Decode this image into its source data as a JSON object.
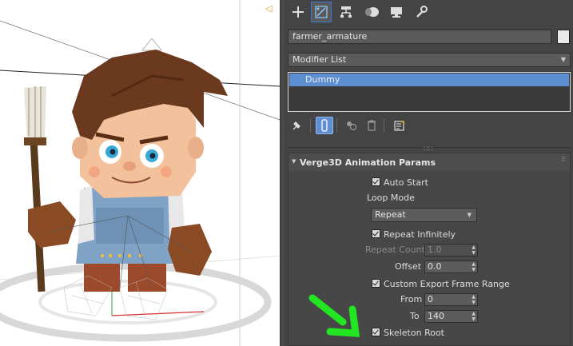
{
  "viewport": {
    "label": "3D viewport - farmer character",
    "grid_arrow": "◁"
  },
  "tabs": [
    {
      "name": "create",
      "icon": "plus-icon"
    },
    {
      "name": "modify",
      "icon": "modify-icon",
      "active": true
    },
    {
      "name": "hierarchy",
      "icon": "hierarchy-icon"
    },
    {
      "name": "motion",
      "icon": "motion-icon"
    },
    {
      "name": "display",
      "icon": "display-icon"
    },
    {
      "name": "utilities",
      "icon": "wrench-icon"
    }
  ],
  "object": {
    "name": "farmer_armature",
    "color": "#e8e8e8"
  },
  "modifier_list": {
    "label": "Modifier List"
  },
  "stack": {
    "items": [
      "Dummy"
    ]
  },
  "rollout": {
    "title": "Verge3D Animation Params",
    "auto_start": "Auto Start",
    "loop_mode_label": "Loop Mode",
    "loop_mode_value": "Repeat",
    "repeat_infinitely": "Repeat Infinitely",
    "repeat_count_label": "Repeat Count",
    "repeat_count_value": "1.0",
    "offset_label": "Offset",
    "offset_value": "0.0",
    "custom_export": "Custom Export Frame Range",
    "from_label": "From",
    "from_value": "0",
    "to_label": "To",
    "to_value": "140",
    "skeleton_root": "Skeleton Root"
  },
  "colors": {
    "accent": "#5b8fd1",
    "annotation_arrow": "#22e622",
    "panel_bg": "#444444"
  }
}
